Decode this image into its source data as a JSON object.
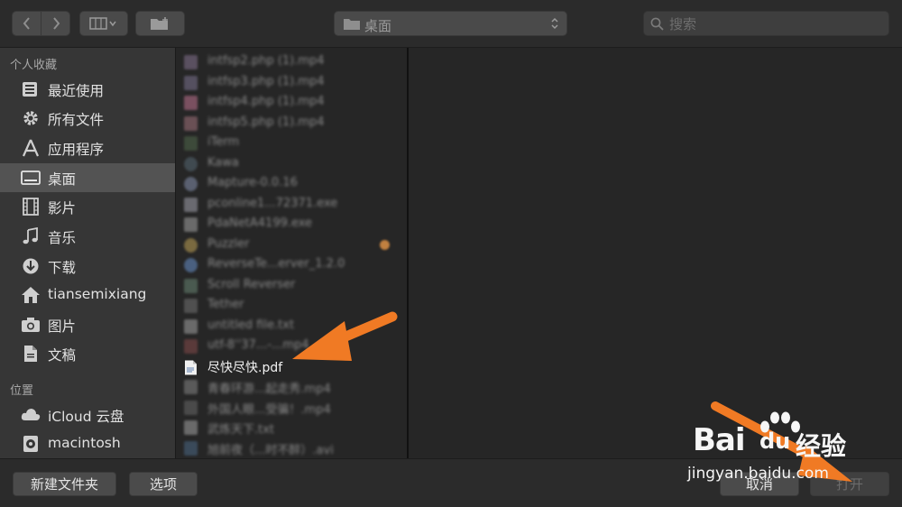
{
  "toolbar": {
    "back_icon": "chevron-left-icon",
    "forward_icon": "chevron-right-icon",
    "view_icon": "column-view-icon",
    "new_folder_icon": "folder-plus-icon",
    "location": "桌面",
    "search_placeholder": "搜索"
  },
  "sidebar": {
    "favorites_header": "个人收藏",
    "favorites": [
      {
        "label": "最近使用",
        "icon": "recents-icon"
      },
      {
        "label": "所有文件",
        "icon": "gear-icon"
      },
      {
        "label": "应用程序",
        "icon": "applications-icon"
      },
      {
        "label": "桌面",
        "icon": "desktop-icon",
        "selected": true
      },
      {
        "label": "影片",
        "icon": "film-icon"
      },
      {
        "label": "音乐",
        "icon": "music-note-icon"
      },
      {
        "label": "下载",
        "icon": "download-icon"
      },
      {
        "label": "tiansemixiang",
        "icon": "home-icon"
      },
      {
        "label": "图片",
        "icon": "camera-icon"
      },
      {
        "label": "文稿",
        "icon": "document-icon"
      }
    ],
    "locations_header": "位置",
    "locations": [
      {
        "label": "iCloud 云盘",
        "icon": "cloud-icon"
      },
      {
        "label": "macintosh",
        "icon": "disk-icon"
      }
    ]
  },
  "files": [
    {
      "name": "intfsp2.php (1).mp4",
      "icon_color": "#5a5060"
    },
    {
      "name": "intfsp3.php (1).mp4",
      "icon_color": "#555060"
    },
    {
      "name": "intfsp4.php (1).mp4",
      "icon_color": "#7a5060"
    },
    {
      "name": "intfsp5.php (1).mp4",
      "icon_color": "#6a5055"
    },
    {
      "name": "iTerm",
      "icon_color": "#3d4a3a"
    },
    {
      "name": "Kawa",
      "icon_color": "#404a50"
    },
    {
      "name": "Mapture-0.0.16",
      "icon_color": "#5a6070"
    },
    {
      "name": "pconline1...72371.exe",
      "icon_color": "#6a6a70"
    },
    {
      "name": "PdaNetA4199.exe",
      "icon_color": "#6a6a6a"
    },
    {
      "name": "Puzzler",
      "icon_color": "#7a6a40"
    },
    {
      "name": "ReverseTe...erver_1.2.0",
      "icon_color": "#4a6080"
    },
    {
      "name": "Scroll Reverser",
      "icon_color": "#4a5a50"
    },
    {
      "name": "Tether",
      "icon_color": "#505050"
    },
    {
      "name": "untitled file.txt",
      "icon_color": "#6a6a6a"
    },
    {
      "name": "utf-8''37...-...mp4",
      "icon_color": "#5a3a3a"
    },
    {
      "name": "尽快尽快.pdf",
      "icon_color": "#e8e8e8",
      "clear": true
    },
    {
      "name": "青春环游...起走秀.mp4",
      "icon_color": "#5a5a5a"
    },
    {
      "name": "外国人眼...受骗！.mp4",
      "icon_color": "#4a4a4a"
    },
    {
      "name": "武炼天下.txt",
      "icon_color": "#6a6a6a"
    },
    {
      "name": "旭前夜（...时不醉）.avi",
      "icon_color": "#3a4a5a"
    }
  ],
  "buttons": {
    "new_folder": "新建文件夹",
    "options": "选项",
    "cancel": "取消",
    "open": "打开"
  },
  "watermark": {
    "brand": "Bai",
    "brand_du": "du",
    "product": "经验",
    "url": "jingyan.baidu.com"
  },
  "colors": {
    "arrow": "#f07a24",
    "selected": "#535353"
  }
}
